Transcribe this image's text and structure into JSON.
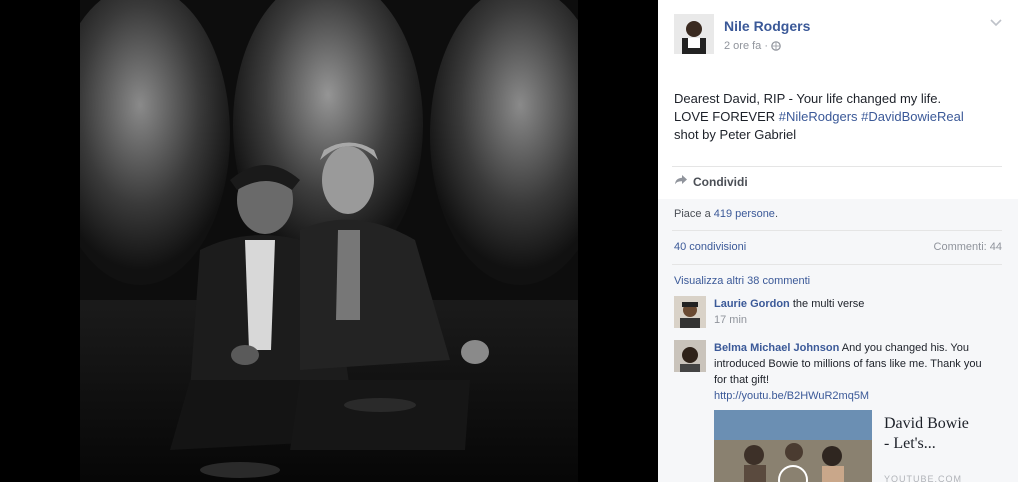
{
  "post": {
    "author": "Nile Rodgers",
    "time": "2 ore fa",
    "dot": "·",
    "text_line1": "Dearest David, RIP - Your life changed my life.",
    "text_line2_prefix": "LOVE FOREVER",
    "hashtag1": "#NileRodgers",
    "hashtag2": "#DavidBowieReal",
    "text_line3": "shot by Peter Gabriel"
  },
  "actions": {
    "share_label": "Condividi"
  },
  "feedback": {
    "likes_prefix": "Piace a",
    "likes_link": "419 persone",
    "likes_suffix": ".",
    "shares": "40 condivisioni",
    "comments_count": "Commenti: 44",
    "view_more": "Visualizza altri 38 commenti"
  },
  "comments": [
    {
      "name": "Laurie Gordon",
      "text": "the multi verse",
      "time": "17 min"
    },
    {
      "name": "Belma Michael Johnson",
      "text": "And you changed his. You introduced Bowie to millions of fans like me. Thank you for that gift!",
      "url": "http://youtu.be/B2HWuR2mq5M",
      "preview_title_line1": "David Bowie",
      "preview_title_line2": "- Let's...",
      "preview_source": "YOUTUBE.COM"
    }
  ]
}
